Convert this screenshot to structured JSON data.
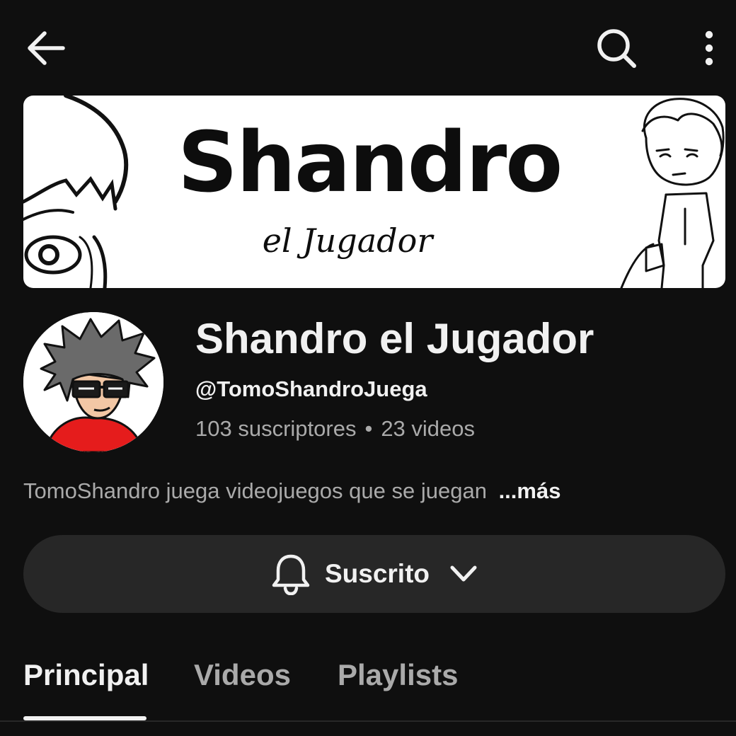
{
  "topbar": {
    "back_icon": "arrow-left-icon",
    "search_icon": "search-icon",
    "more_icon": "more-vertical-icon"
  },
  "banner": {
    "title": "Shandro",
    "subtitle": "el Jugador"
  },
  "channel": {
    "name": "Shandro el Jugador",
    "handle": "@TomoShandroJuega",
    "subscribers": "103 suscriptores",
    "separator": "•",
    "videos": "23 videos",
    "description": "TomoShandro juega videojuegos que se juegan",
    "more_label": "...más"
  },
  "subscribe": {
    "label": "Suscrito",
    "bell_icon": "bell-icon",
    "chevron_icon": "chevron-down-icon"
  },
  "tabs": [
    {
      "label": "Principal",
      "active": true
    },
    {
      "label": "Videos",
      "active": false
    },
    {
      "label": "Playlists",
      "active": false
    }
  ],
  "colors": {
    "background": "#0f0f0f",
    "button_bg": "#272727",
    "text_primary": "#f1f1f1",
    "text_secondary": "#aaaaaa",
    "avatar_accent": "#e51c1c"
  }
}
